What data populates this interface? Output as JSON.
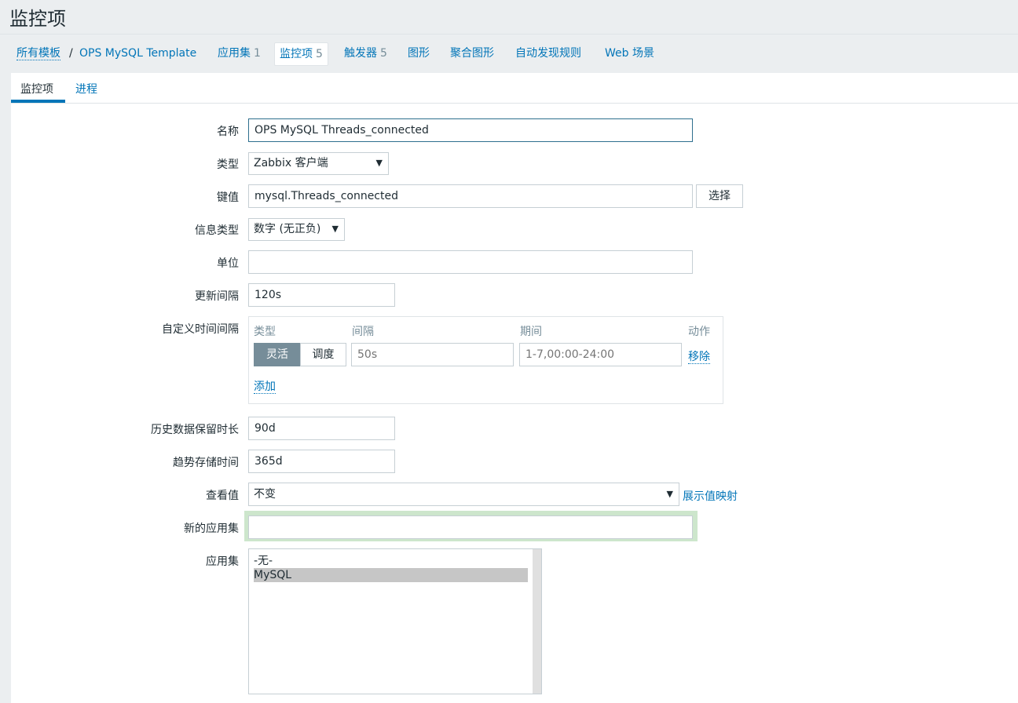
{
  "page": {
    "title": "监控项"
  },
  "nav": {
    "all_templates": "所有模板",
    "separator": "/",
    "template": "OPS MySQL Template",
    "applications": {
      "label": "应用集",
      "count": "1"
    },
    "items": {
      "label": "监控项",
      "count": "5"
    },
    "triggers": {
      "label": "触发器",
      "count": "5"
    },
    "graphs": "图形",
    "screens": "聚合图形",
    "discovery": "自动发现规则",
    "web": "Web 场景"
  },
  "tabs": {
    "item": "监控项",
    "preprocessing": "进程"
  },
  "form": {
    "name": {
      "label": "名称",
      "value": "OPS MySQL Threads_connected"
    },
    "type": {
      "label": "类型",
      "value": "Zabbix 客户端"
    },
    "key": {
      "label": "键值",
      "value": "mysql.Threads_connected",
      "select_button": "选择"
    },
    "value_type": {
      "label": "信息类型",
      "value": "数字 (无正负)"
    },
    "units": {
      "label": "单位",
      "value": ""
    },
    "delay": {
      "label": "更新间隔",
      "value": "120s"
    },
    "custom_intervals": {
      "label": "自定义时间间隔",
      "headers": {
        "type": "类型",
        "interval": "间隔",
        "period": "期间",
        "action": "动作"
      },
      "flexible": "灵活",
      "scheduling": "调度",
      "interval_placeholder": "50s",
      "period_placeholder": "1-7,00:00-24:00",
      "remove": "移除",
      "add": "添加"
    },
    "history": {
      "label": "历史数据保留时长",
      "value": "90d"
    },
    "trends": {
      "label": "趋势存储时间",
      "value": "365d"
    },
    "valuemap": {
      "label": "查看值",
      "value": "不变",
      "link": "展示值映射"
    },
    "new_application": {
      "label": "新的应用集",
      "value": ""
    },
    "applications": {
      "label": "应用集",
      "options": [
        "-无-",
        "MySQL"
      ]
    }
  },
  "icons": {
    "dropdown": "▼"
  },
  "colors": {
    "link": "#0275b8",
    "text": "#1f2c33",
    "muted": "#768d99",
    "focus_highlight": "#cde6cc"
  }
}
